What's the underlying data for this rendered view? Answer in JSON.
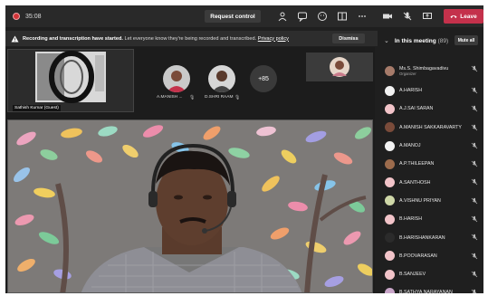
{
  "topbar": {
    "timer": "35:08",
    "request_control_label": "Request control",
    "leave_label": "Leave"
  },
  "banner": {
    "bold_text": "Recording and transcription have started.",
    "message": "Let everyone know they're being recorded and transcribed.",
    "link_text": "Privacy policy",
    "dismiss_label": "Dismiss"
  },
  "stage": {
    "share_name": "Sathish Kumar (Guest)",
    "tiles": [
      {
        "label": "A.MANISH ..."
      },
      {
        "label": "D.SHRI RAAM"
      }
    ],
    "more_count": "+85"
  },
  "panel": {
    "title": "In this meeting",
    "count": "(89)",
    "mute_all_label": "Mute all",
    "participants": [
      {
        "name": "Ms.S. Shimbagavadivu",
        "role": "Organizer",
        "avatar_color": "#a67b6a"
      },
      {
        "name": "A.HARISH",
        "role": "",
        "avatar_color": "#f2f2f2"
      },
      {
        "name": "A.J.SAI SARAN",
        "role": "",
        "avatar_color": "#f2c4c9"
      },
      {
        "name": "A.MANISH SAKKARAVARTY",
        "role": "",
        "avatar_color": "#7a4b3a"
      },
      {
        "name": "A.MANOJ",
        "role": "",
        "avatar_color": "#f2f2f2"
      },
      {
        "name": "A.P.THILEEPAN",
        "role": "",
        "avatar_color": "#9c6b4c"
      },
      {
        "name": "A.SANTHOSH",
        "role": "",
        "avatar_color": "#f2c4c9"
      },
      {
        "name": "A.VISHNU PRIYAN",
        "role": "",
        "avatar_color": "#cfd8a8"
      },
      {
        "name": "B.HARISH",
        "role": "",
        "avatar_color": "#f2c4c9"
      },
      {
        "name": "B.HARISHANKARAN",
        "role": "",
        "avatar_color": "#2b2b2b"
      },
      {
        "name": "B.POOVARASAN",
        "role": "",
        "avatar_color": "#f2c4c9"
      },
      {
        "name": "B.SANJEEV",
        "role": "",
        "avatar_color": "#f2c4c9"
      },
      {
        "name": "B.SATHYA NARAYANAN",
        "role": "",
        "avatar_color": "#c9a6c9"
      }
    ]
  },
  "colors": {
    "leave": "#c4314b",
    "recording": "#d13438",
    "background": "#1f1f1f"
  }
}
